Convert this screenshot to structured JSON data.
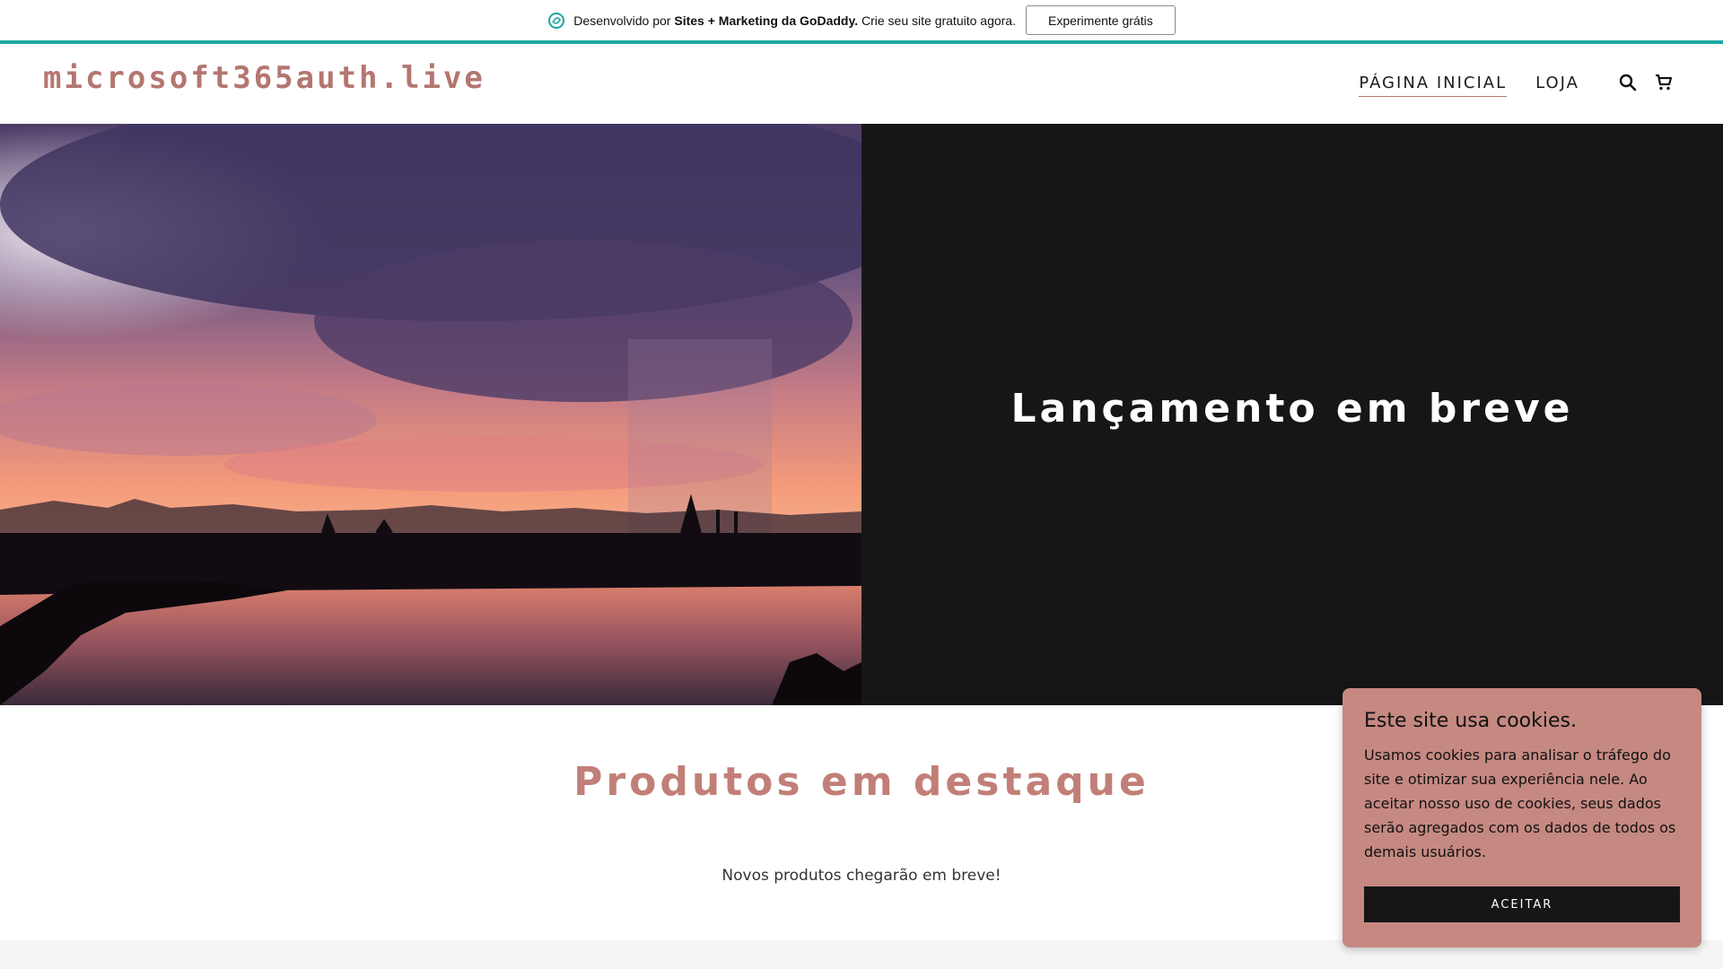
{
  "promo": {
    "prefix": "Desenvolvido por ",
    "brand": "Sites + Marketing da GoDaddy.",
    "suffix": " Crie seu site gratuito agora.",
    "button_label": "Experimente grátis",
    "accent_color": "#1ba7a0"
  },
  "header": {
    "logo": "microsoft365auth.live",
    "nav": [
      {
        "label": "PÁGINA INICIAL",
        "active": true
      },
      {
        "label": "LOJA",
        "active": false
      }
    ],
    "icons": [
      "search-icon",
      "cart-icon"
    ],
    "brand_color": "#b47670"
  },
  "hero": {
    "title": "Lançamento em breve",
    "image": "sunset-rain-lake-photo",
    "panel_color": "#161617"
  },
  "featured": {
    "title": "Produtos em destaque",
    "message": "Novos produtos chegarão em breve!"
  },
  "cookie": {
    "title": "Este site usa cookies.",
    "body": "Usamos cookies para analisar o tráfego do site e otimizar sua experiência nele. Ao aceitar nosso uso de cookies, seus dados serão agregados com os dados de todos os demais usuários.",
    "button_label": "ACEITAR",
    "background": "#c58981"
  }
}
